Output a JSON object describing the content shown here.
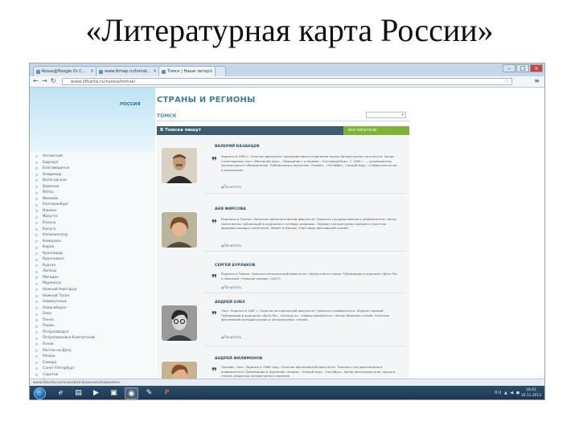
{
  "slide_title": "«Литературная карта России»",
  "browser": {
    "tabs": [
      {
        "label": "Rossa@Hoogle Or C..."
      },
      {
        "label": "www.litmap.ru/tomsk..."
      },
      {
        "label": "Томск | Наши литер...",
        "active": true
      },
      {
        "label": ""
      }
    ],
    "url": "www.litkarta.ru/russia/tomsk/",
    "status_url": "www.litkarta.ru/russia/tomsk/persons/kazantsev"
  },
  "page": {
    "region_label": "РОССИЯ",
    "section_title": "СТРАНЫ И РЕГИОНЫ",
    "city": "ТОМСК",
    "select_value": "",
    "dark_bar": "В Томске пишут",
    "green_bar": "все писатели",
    "more_label": "Почитать",
    "regions": [
      "Алтайский",
      "Барнаул",
      "Благовещенск",
      "Владимир",
      "Вологодская",
      "Воронеж",
      "Вятка",
      "Иваново",
      "Екатеринбург",
      "Ижевск",
      "Иркутск",
      "Казань",
      "Калуга",
      "Калининград",
      "Кемерово",
      "Киров",
      "Краснодар",
      "Красноярск",
      "Курган",
      "Липецк",
      "Магадан",
      "Мурманск",
      "Нижний Новгород",
      "Нижний Тагил",
      "Новокузнецк",
      "Новосибирск",
      "Омск",
      "Пенза",
      "Пермь",
      "Петрозаводск",
      "Петропавловск-Камчатский",
      "Псков",
      "Ростов-на-Дону",
      "Рязань",
      "Самара",
      "Санкт-Петербург",
      "Саратов",
      "Смоленск",
      "Тамбов",
      "Тверь"
    ],
    "entries": [
      {
        "name": "ВАЛЕРИЙ КАЗАНЦЕВ",
        "desc": "Родился в 1950 г. Окончил факультет журналистики и отделение прозы Литературного института. Автор стихотворных книг «Вечерний дом», «Прощание с птицами», «Сосновый бор». С 1995 г. — руководитель литературного объединения. Публикации в журналах «Знамя», «Октябрь», «Новый мир», «Сибирские огни» и альманахах."
      },
      {
        "name": "АНЯ ФИРСОВА",
        "desc": "Родилась в Томске. Окончила филологический факультет Томского государственного университета. Автор поэтических публикаций в журналах и сетевых изданиях. Лауреат литературных премий и участник форумов молодых писателей. Живёт в Москве. Участница фестивалей поэзии."
      },
      {
        "name": "СЕРГЕЙ БУРЛАКОВ",
        "desc": "Родился в Томске. Окончил исторический факультет. Автор книги стихов. Публикации в журнале «Дети Ра» и сборнике «Томская поэзия» (2007)."
      },
      {
        "name": "АНДРЕЙ ОЛЕХ",
        "desc": "Поэт. Родился в 1987 г. Окончил исторический факультет Томского университета. Лауреат премий. Публикации в журналах «Дети Ра», «Кольцо А», «Новая реальность». Автор сборника стихов. Участник фестивалей молодой поэзии и литературных чтений."
      },
      {
        "name": "АНДРЕЙ ФИЛИМОНОВ",
        "desc": "Прозаик, поэт. Родился в 1969 году. Окончил философский факультет Томского государственного университета. Публикации в журналах «Знамя», «Новый мир», «Октябрь». Автор нескольких книг прозы и стихов, редактор литературного журнала."
      }
    ]
  },
  "taskbar": {
    "tray": "RU ▲ ◀ ◼",
    "time": "18:41",
    "date": "19.11.2013"
  },
  "colors": {
    "dark_bar": "#3f5d70",
    "green_bar": "#7fb23a",
    "section_title": "#3f7f9f"
  }
}
